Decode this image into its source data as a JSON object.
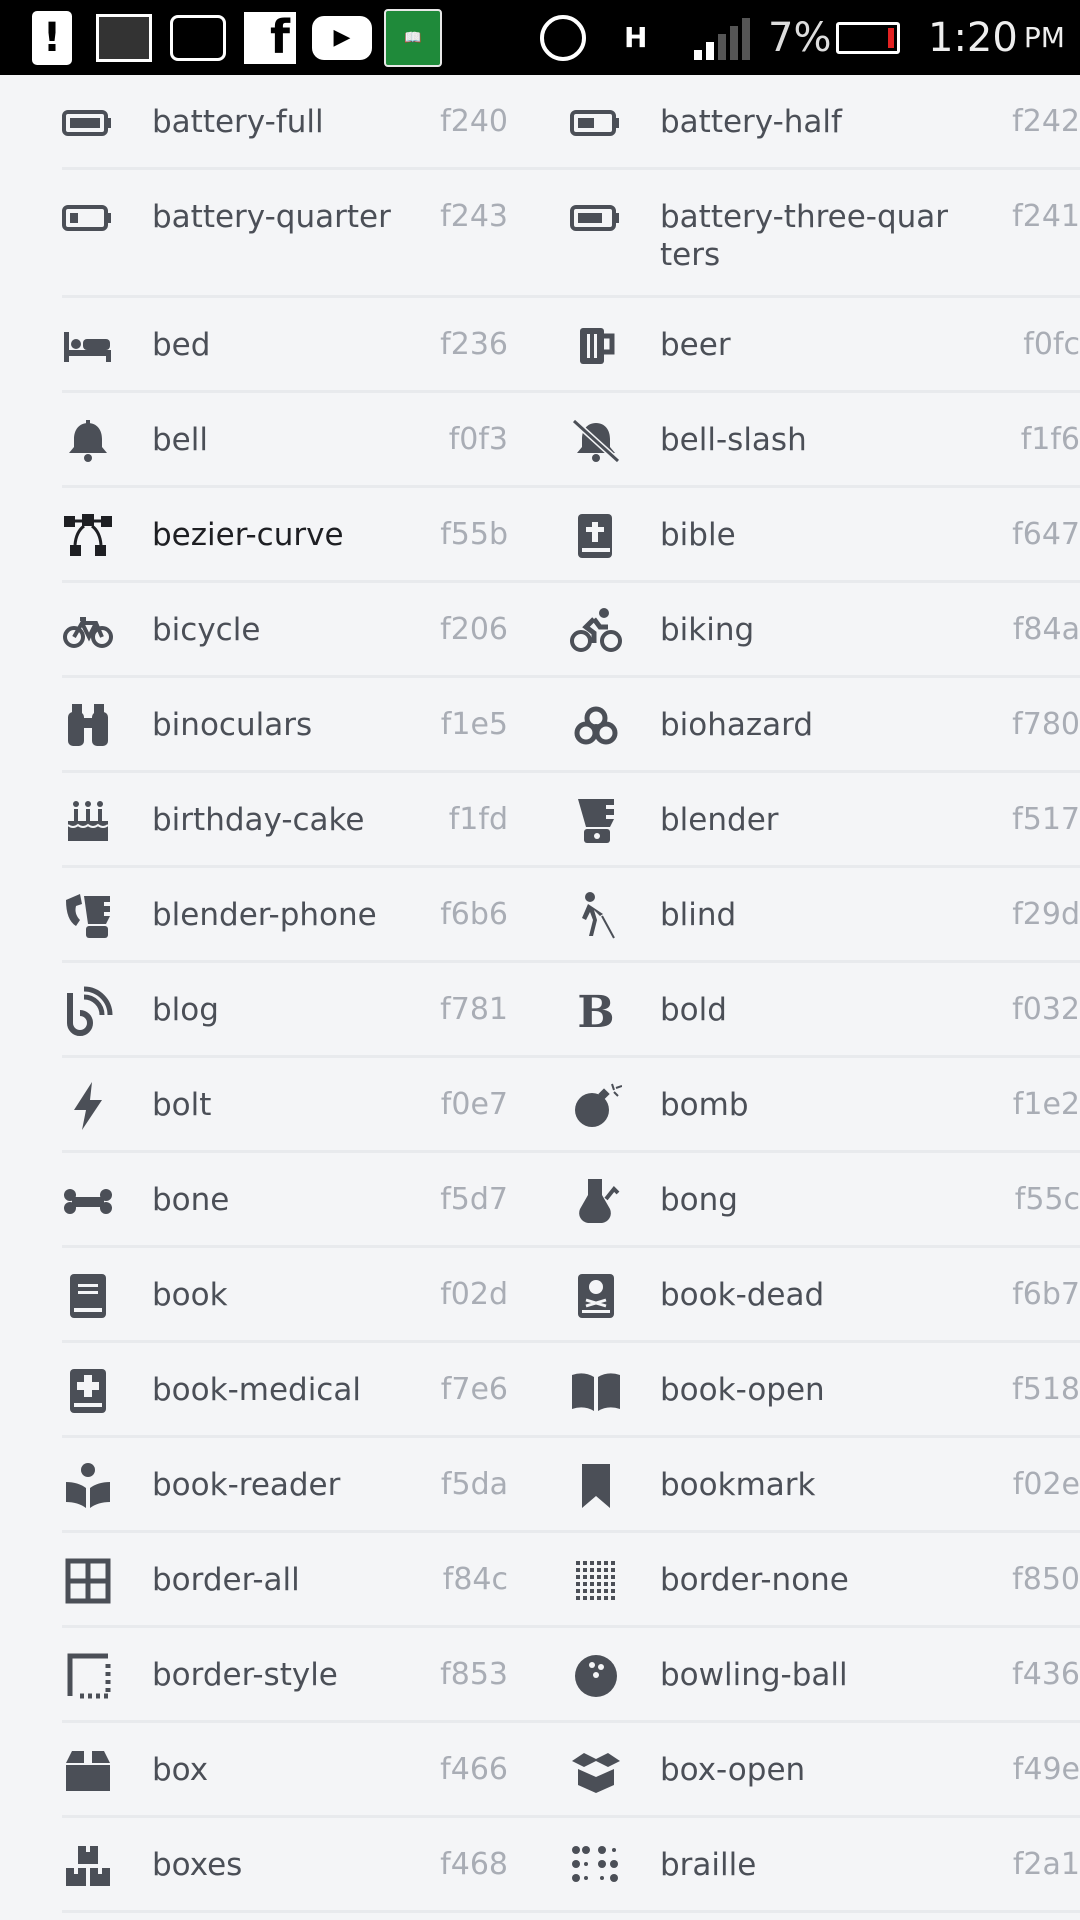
{
  "status_bar": {
    "network": "H",
    "battery_percent": "7%",
    "time": "1:20",
    "ampm": "PM",
    "battery_fill": 0.07,
    "colors": {
      "background": "#000000",
      "battery_low": "#e32222"
    }
  },
  "rows": [
    {
      "left": {
        "name": "battery-full",
        "code": "f240",
        "icon": "battery-full-icon"
      },
      "right": {
        "name": "battery-half",
        "code": "f242",
        "icon": "battery-half-icon"
      }
    },
    {
      "left": {
        "name": "battery-quarter",
        "code": "f243",
        "icon": "battery-quarter-icon"
      },
      "right": {
        "name": "battery-three-quar",
        "name2": "ters",
        "code": "f241",
        "icon": "battery-three-quarters-icon"
      }
    },
    {
      "left": {
        "name": "bed",
        "code": "f236",
        "icon": "bed-icon"
      },
      "right": {
        "name": "beer",
        "code": "f0fc",
        "icon": "beer-icon"
      }
    },
    {
      "left": {
        "name": "bell",
        "code": "f0f3",
        "icon": "bell-icon"
      },
      "right": {
        "name": "bell-slash",
        "code": "f1f6",
        "icon": "bell-slash-icon"
      }
    },
    {
      "left": {
        "name": "bezier-curve",
        "code": "f55b",
        "icon": "bezier-curve-icon"
      },
      "right": {
        "name": "bible",
        "code": "f647",
        "icon": "bible-icon"
      }
    },
    {
      "left": {
        "name": "bicycle",
        "code": "f206",
        "icon": "bicycle-icon"
      },
      "right": {
        "name": "biking",
        "code": "f84a",
        "icon": "biking-icon"
      }
    },
    {
      "left": {
        "name": "binoculars",
        "code": "f1e5",
        "icon": "binoculars-icon"
      },
      "right": {
        "name": "biohazard",
        "code": "f780",
        "icon": "biohazard-icon"
      }
    },
    {
      "left": {
        "name": "birthday-cake",
        "code": "f1fd",
        "icon": "birthday-cake-icon"
      },
      "right": {
        "name": "blender",
        "code": "f517",
        "icon": "blender-icon"
      }
    },
    {
      "left": {
        "name": "blender-phone",
        "code": "f6b6",
        "icon": "blender-phone-icon"
      },
      "right": {
        "name": "blind",
        "code": "f29d",
        "icon": "blind-icon"
      }
    },
    {
      "left": {
        "name": "blog",
        "code": "f781",
        "icon": "blog-icon"
      },
      "right": {
        "name": "bold",
        "code": "f032",
        "icon": "bold-icon"
      }
    },
    {
      "left": {
        "name": "bolt",
        "code": "f0e7",
        "icon": "bolt-icon"
      },
      "right": {
        "name": "bomb",
        "code": "f1e2",
        "icon": "bomb-icon"
      }
    },
    {
      "left": {
        "name": "bone",
        "code": "f5d7",
        "icon": "bone-icon"
      },
      "right": {
        "name": "bong",
        "code": "f55c",
        "icon": "bong-icon"
      }
    },
    {
      "left": {
        "name": "book",
        "code": "f02d",
        "icon": "book-icon"
      },
      "right": {
        "name": "book-dead",
        "code": "f6b7",
        "icon": "book-dead-icon"
      }
    },
    {
      "left": {
        "name": "book-medical",
        "code": "f7e6",
        "icon": "book-medical-icon"
      },
      "right": {
        "name": "book-open",
        "code": "f518",
        "icon": "book-open-icon"
      }
    },
    {
      "left": {
        "name": "book-reader",
        "code": "f5da",
        "icon": "book-reader-icon"
      },
      "right": {
        "name": "bookmark",
        "code": "f02e",
        "icon": "bookmark-icon"
      }
    },
    {
      "left": {
        "name": "border-all",
        "code": "f84c",
        "icon": "border-all-icon"
      },
      "right": {
        "name": "border-none",
        "code": "f850",
        "icon": "border-none-icon"
      }
    },
    {
      "left": {
        "name": "border-style",
        "code": "f853",
        "icon": "border-style-icon"
      },
      "right": {
        "name": "bowling-ball",
        "code": "f436",
        "icon": "bowling-ball-icon"
      }
    },
    {
      "left": {
        "name": "box",
        "code": "f466",
        "icon": "box-icon"
      },
      "right": {
        "name": "box-open",
        "code": "f49e",
        "icon": "box-open-icon"
      }
    },
    {
      "left": {
        "name": "boxes",
        "code": "f468",
        "icon": "boxes-icon"
      },
      "right": {
        "name": "braille",
        "code": "f2a1",
        "icon": "braille-icon"
      }
    }
  ]
}
